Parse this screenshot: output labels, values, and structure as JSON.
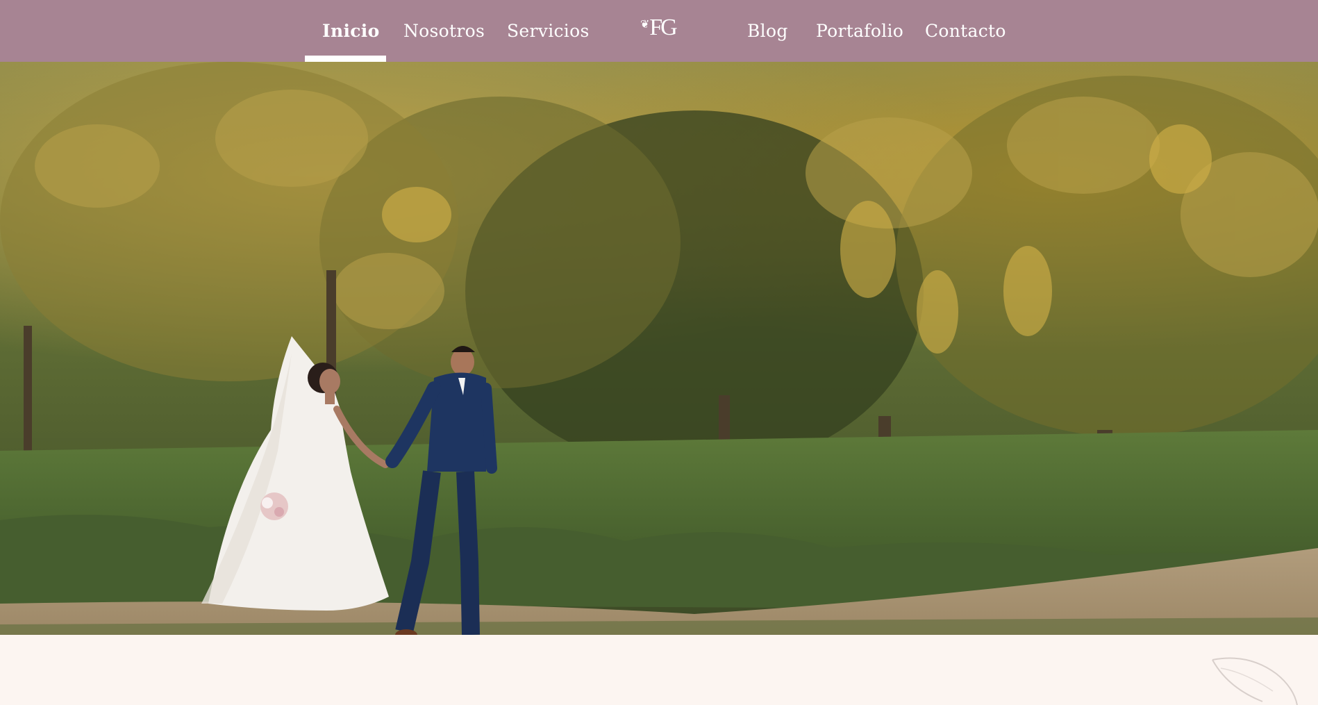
{
  "nav": {
    "items": [
      {
        "label": "Inicio",
        "active": true
      },
      {
        "label": "Nosotros",
        "active": false
      },
      {
        "label": "Servicios",
        "active": false
      },
      {
        "label": "Blog",
        "active": false
      },
      {
        "label": "Portafolio",
        "active": false
      },
      {
        "label": "Contacto",
        "active": false
      }
    ],
    "logo": "FG"
  },
  "hero": {
    "image": "bride-and-groom-walking-in-park"
  },
  "colors": {
    "nav_background": "#a78493",
    "nav_text": "#ffffff",
    "page_background": "#fcf5f1"
  },
  "icons": {
    "decoration": "leaf-outline-icon"
  }
}
